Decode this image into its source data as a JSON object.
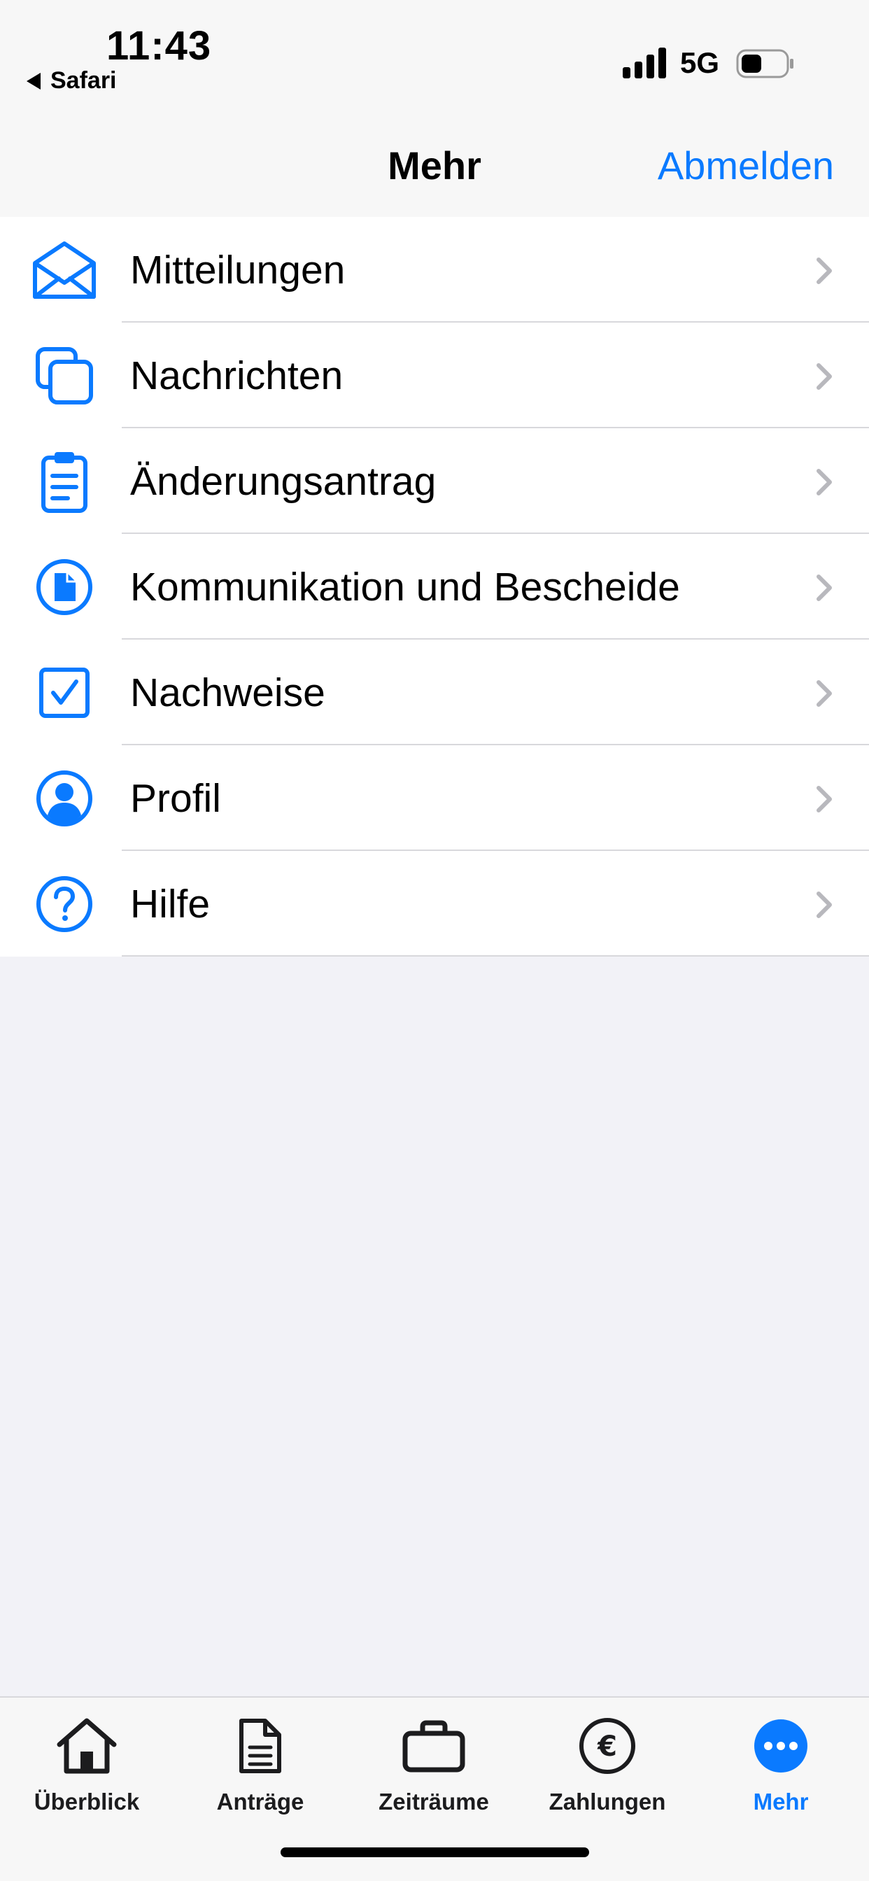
{
  "status_bar": {
    "time": "11:43",
    "back_app": "Safari",
    "network": "5G"
  },
  "nav": {
    "title": "Mehr",
    "action": "Abmelden"
  },
  "menu": {
    "items": [
      {
        "label": "Mitteilungen",
        "icon": "envelope-icon"
      },
      {
        "label": "Nachrichten",
        "icon": "copy-icon"
      },
      {
        "label": "Änderungsantrag",
        "icon": "clipboard-icon"
      },
      {
        "label": "Kommunikation und Bescheide",
        "icon": "document-circle-icon"
      },
      {
        "label": "Nachweise",
        "icon": "checkbox-icon"
      },
      {
        "label": "Profil",
        "icon": "person-circle-icon"
      },
      {
        "label": "Hilfe",
        "icon": "question-circle-icon"
      }
    ]
  },
  "tabs": [
    {
      "label": "Überblick",
      "icon": "house-icon"
    },
    {
      "label": "Anträge",
      "icon": "document-icon"
    },
    {
      "label": "Zeiträume",
      "icon": "briefcase-icon"
    },
    {
      "label": "Zahlungen",
      "icon": "euro-icon"
    },
    {
      "label": "Mehr",
      "icon": "more-icon",
      "active": true
    }
  ],
  "colors": {
    "accent": "#0a7aff",
    "background": "#f2f2f7",
    "bar": "#f7f7f7"
  }
}
